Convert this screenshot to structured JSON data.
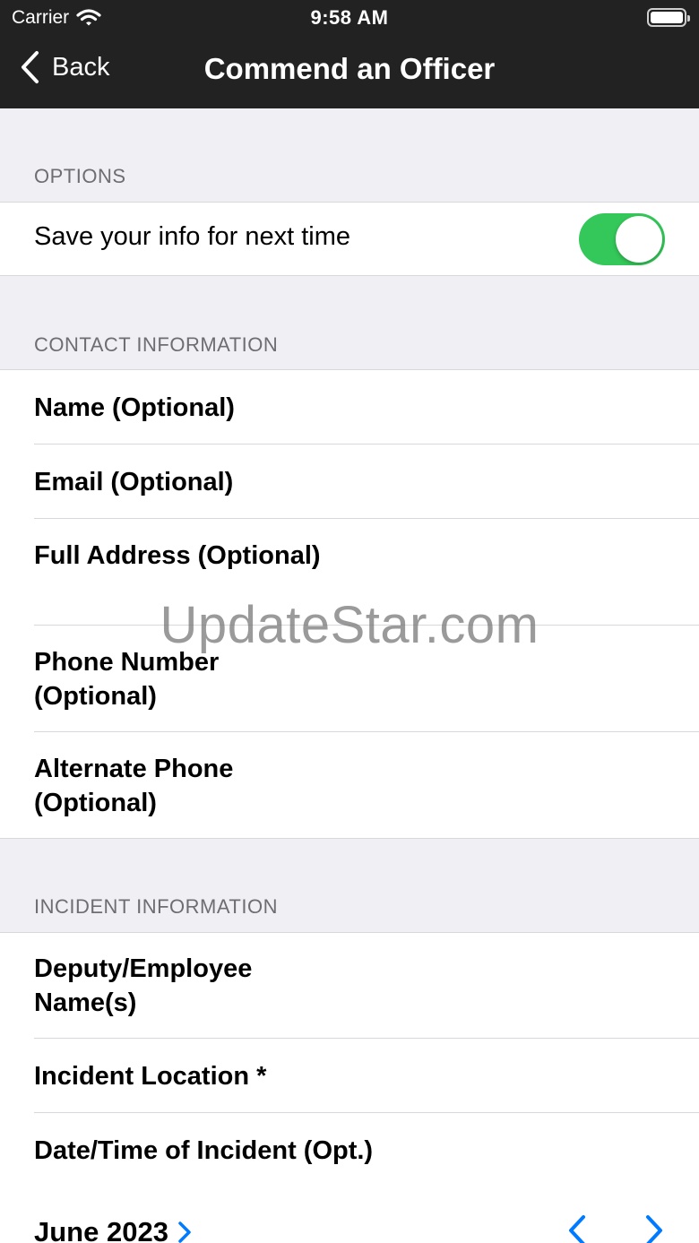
{
  "status_bar": {
    "carrier": "Carrier",
    "time": "9:58 AM"
  },
  "nav": {
    "back_label": "Back",
    "title": "Commend an Officer"
  },
  "options": {
    "header": "OPTIONS",
    "save_info_label": "Save your info for next time",
    "save_info_enabled": true
  },
  "contact": {
    "header": "CONTACT INFORMATION",
    "fields": [
      "Name (Optional)",
      "Email (Optional)",
      "Full Address (Optional)",
      "Phone Number (Optional)",
      "Alternate Phone (Optional)"
    ]
  },
  "incident": {
    "header": "INCIDENT INFORMATION",
    "fields": [
      "Deputy/Employee Name(s)",
      "Incident Location *",
      "Date/Time of Incident (Opt.)"
    ]
  },
  "calendar": {
    "month_label": "June 2023"
  },
  "watermark": "UpdateStar.com",
  "colors": {
    "nav_bg": "#222222",
    "toggle_on": "#34c759",
    "accent": "#007aff",
    "page_bg": "#efeff4"
  }
}
